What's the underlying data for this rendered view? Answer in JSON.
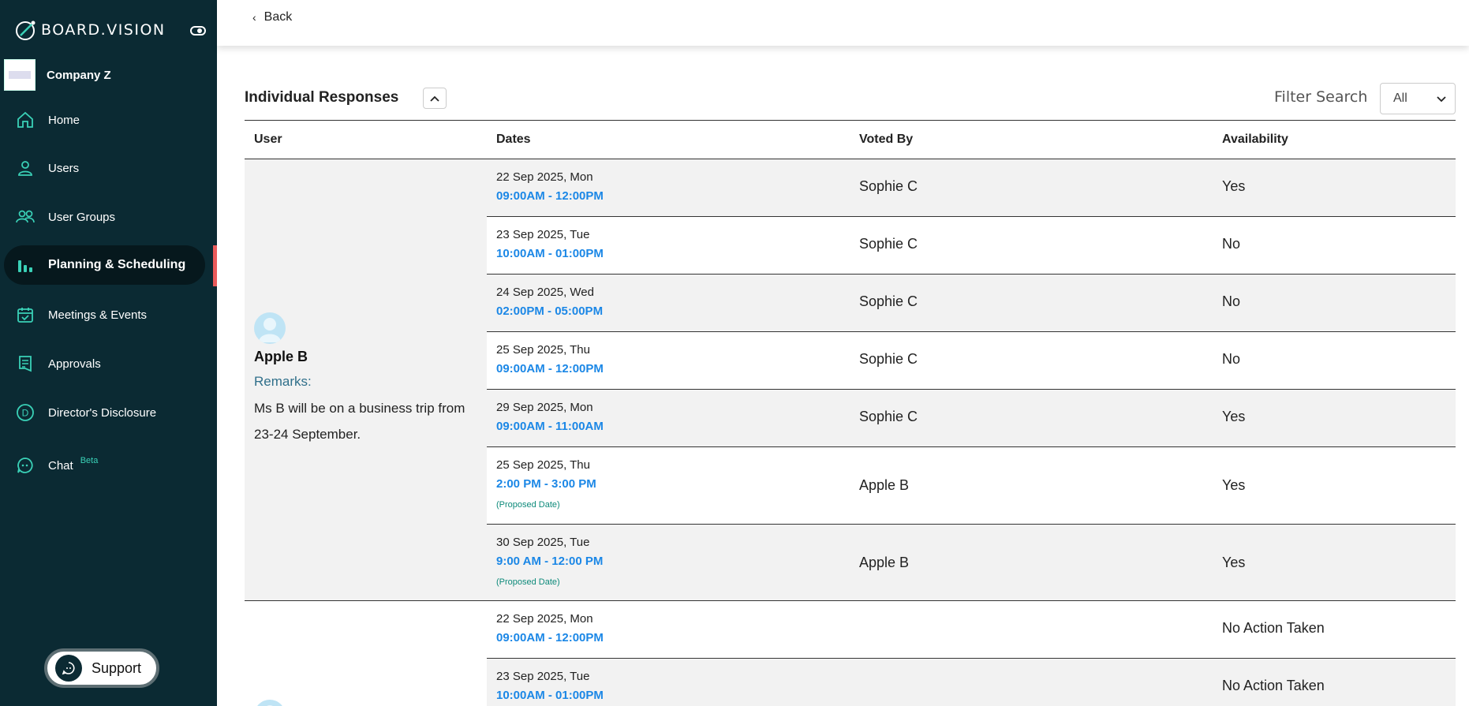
{
  "brand": {
    "name": "BOARD.VISION"
  },
  "company": {
    "name": "Company Z"
  },
  "nav": [
    {
      "label": "Home",
      "icon": "home-icon"
    },
    {
      "label": "Users",
      "icon": "user-icon"
    },
    {
      "label": "User Groups",
      "icon": "users-icon"
    },
    {
      "label": "Planning & Scheduling",
      "icon": "bar-chart-icon",
      "active": true
    },
    {
      "label": "Meetings & Events",
      "icon": "calendar-check-icon"
    },
    {
      "label": "Approvals",
      "icon": "document-icon"
    },
    {
      "label": "Director's Disclosure",
      "icon": "d-circle-icon"
    },
    {
      "label": "Chat",
      "icon": "chat-icon",
      "badge": "Beta"
    }
  ],
  "support": {
    "label": "Support"
  },
  "topbar": {
    "back_label": "Back"
  },
  "section": {
    "title": "Individual Responses",
    "filter_label": "Filter Search",
    "filter_value": "All"
  },
  "table": {
    "headers": [
      "User",
      "Dates",
      "Voted By",
      "Availability"
    ],
    "groups": [
      {
        "user": "Apple B",
        "remarks_label": "Remarks:",
        "remarks": "Ms B will be on a business trip from 23-24 September.",
        "rows": [
          {
            "date": "22 Sep 2025, Mon",
            "time": "09:00AM - 12:00PM",
            "voted_by": "Sophie C",
            "availability": "Yes"
          },
          {
            "date": "23 Sep 2025, Tue",
            "time": "10:00AM - 01:00PM",
            "voted_by": "Sophie C",
            "availability": "No"
          },
          {
            "date": "24 Sep 2025, Wed",
            "time": "02:00PM - 05:00PM",
            "voted_by": "Sophie C",
            "availability": "No"
          },
          {
            "date": "25 Sep 2025, Thu",
            "time": "09:00AM - 12:00PM",
            "voted_by": "Sophie C",
            "availability": "No"
          },
          {
            "date": "29 Sep 2025, Mon",
            "time": "09:00AM - 11:00AM",
            "voted_by": "Sophie C",
            "availability": "Yes"
          },
          {
            "date": "25 Sep 2025, Thu",
            "time": "2:00 PM - 3:00 PM",
            "note": "(Proposed Date)",
            "voted_by": "Apple B",
            "availability": "Yes"
          },
          {
            "date": "30 Sep 2025, Tue",
            "time": "9:00 AM - 12:00 PM",
            "note": "(Proposed Date)",
            "voted_by": "Apple B",
            "availability": "Yes"
          }
        ]
      },
      {
        "rows": [
          {
            "date": "22 Sep 2025, Mon",
            "time": "09:00AM - 12:00PM",
            "voted_by": "",
            "availability": "No Action Taken"
          },
          {
            "date": "23 Sep 2025, Tue",
            "time": "10:00AM - 01:00PM",
            "voted_by": "",
            "availability": "No Action Taken"
          }
        ]
      }
    ]
  },
  "colors": {
    "sidebar": "#0b2a33",
    "accent": "#3ad1b7",
    "time_blue": "#1b87e6",
    "active_bar": "#ea5b5b"
  }
}
